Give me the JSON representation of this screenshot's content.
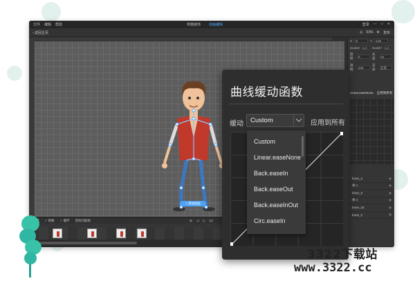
{
  "app": {
    "menu": [
      "文件",
      "编辑",
      "帮助"
    ],
    "center_tabs": [
      "骨骼装饰",
      "动画编辑"
    ],
    "window_controls": [
      "登录",
      "—",
      "□",
      "✕"
    ],
    "toolbar": {
      "back_label": "‹ 返回主页",
      "zoom": "53%",
      "publish_label": "发布"
    },
    "add_animation_label": "+ 添加动画",
    "props": {
      "rows": [
        [
          "X",
          "Y"
        ],
        [
          "ScaleX",
          "ScaleY"
        ],
        [
          "旋转",
          "长度"
        ],
        [
          "透明",
          "渲染"
        ]
      ],
      "values": [
        [
          "-8",
          "-125"
        ],
        [
          "1.0",
          "1.0"
        ],
        [
          "0",
          "10"
        ],
        [
          "100",
          "正常"
        ]
      ],
      "tabs": [
        "Linear.easeNone",
        "应用到所有"
      ],
      "bones": [
        "bone_4",
        "骨 1",
        "bone_3",
        "骨 2",
        "bone_16",
        "bone_2"
      ]
    },
    "timeline": {
      "items": [
        "帧",
        "✓ 骨骼",
        "✓ 循环",
        "其他功能帧"
      ],
      "controls": [
        "◎",
        "◁",
        "▷",
        "▷|"
      ]
    }
  },
  "easing": {
    "title": "曲线缓动函数",
    "label": "缓动",
    "selected": "Custom",
    "apply_all": "应用到所有",
    "options": [
      "Custom",
      "Linear.easeNone",
      "Back.easeIn",
      "Back.easeOut",
      "Back.easeInOut",
      "Circ.easeIn"
    ]
  },
  "watermark": {
    "line1": "3322下载站",
    "line2": "www.3322.cc"
  },
  "colors": {
    "accent": "#4fa3f7",
    "panel": "#2e2e2e",
    "bubble": "#e3f1ee",
    "plant": "#2fb7a3"
  }
}
